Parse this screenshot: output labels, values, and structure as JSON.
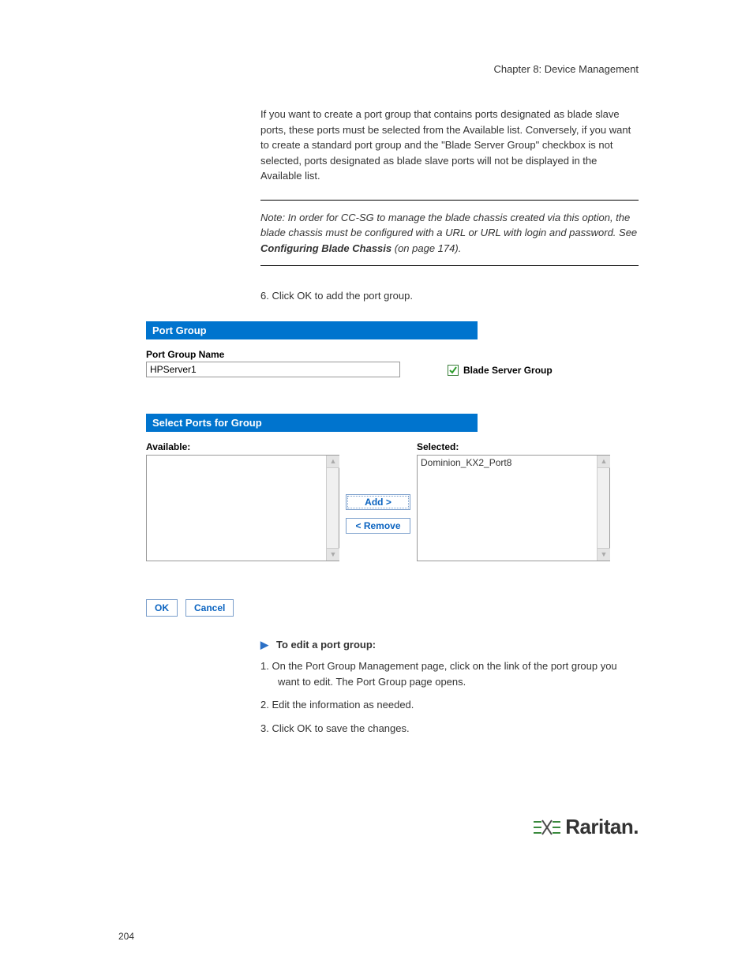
{
  "chapter_head": "Chapter 8: Device Management",
  "intro": "If you want to create a port group that contains ports designated as blade slave ports, these ports must be selected from the Available list. Conversely, if you want to create a standard port group and the \"Blade Server Group\" checkbox is not selected, ports designated as blade slave ports will not be displayed in the Available list.",
  "note": "Note: In order for CC-SG to manage the blade chassis created via this option, the blade chassis must be configured with a URL or URL with login and password. See ",
  "note_link": "Configuring Blade Chassis",
  "note_page_ref": " (on page 174).",
  "step6": "6.  Click OK to add the port group.",
  "ui": {
    "section1": "Port Group",
    "name_label": "Port Group Name",
    "name_value": "HPServer1",
    "cb_label": "Blade Server Group",
    "section2": "Select Ports for Group",
    "avail_label": "Available:",
    "sel_label": "Selected:",
    "selected_item": "Dominion_KX2_Port8",
    "add_btn": "Add >",
    "remove_btn": "< Remove",
    "ok_btn": "OK",
    "cancel_btn": "Cancel"
  },
  "edit_heading": "To edit a port group:",
  "edit1": "1.  On the Port Group Management page, click on the link of the port group you want to edit. The Port Group page opens.",
  "edit2": "2.  Edit the information as needed.",
  "edit3": "3.  Click OK to save the changes.",
  "logo_text": "Raritan.",
  "page_number": "204"
}
